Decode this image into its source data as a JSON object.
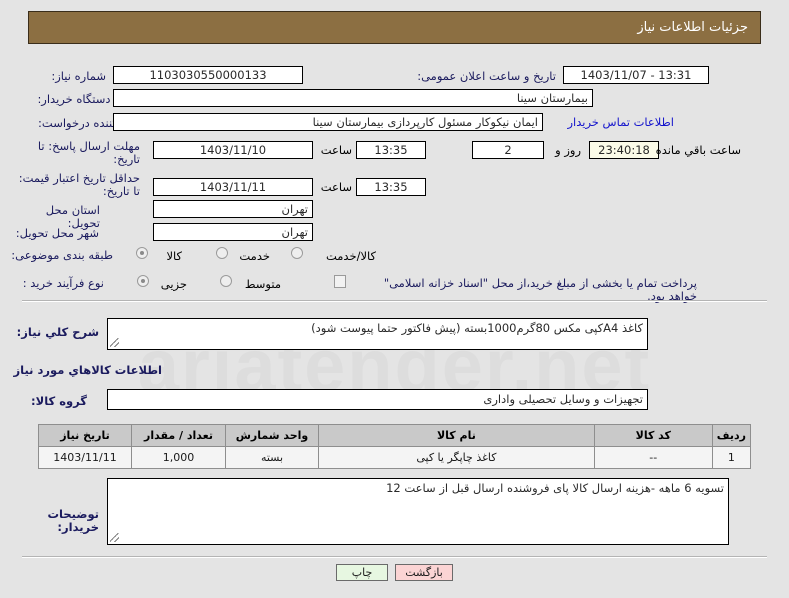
{
  "header": {
    "title": "جزئیات اطلاعات نیاز"
  },
  "watermark": {
    "text": "ariatender.net"
  },
  "fields": {
    "need_number_label": "شماره نیاز:",
    "need_number_value": "1103030550000133",
    "announce_label": "تاریخ و ساعت اعلان عمومی:",
    "announce_value": "13:31 - 1403/11/07",
    "buyer_org_label": "نام دستگاه خریدار:",
    "buyer_org_value": "بیمارستان سینا",
    "creator_label": "ایجاد کننده درخواست:",
    "creator_value": "ایمان نیکوکار مسئول کارپردازی  بیمارستان سینا",
    "contact_link": "اطلاعات تماس خریدار",
    "deadline_label": "مهلت ارسال پاسخ: تا تاریخ:",
    "deadline_date": "1403/11/10",
    "hour_label": "ساعت",
    "deadline_time": "13:35",
    "days_value": "2",
    "days_label": "روز و",
    "countdown_value": "23:40:18",
    "countdown_label": "ساعت باقي مانده",
    "validity_label": "حداقل تاریخ اعتبار قیمت: تا تاریخ:",
    "validity_date": "1403/11/11",
    "validity_time": "13:35",
    "province_label": "استان محل تحویل:",
    "province_value": "تهران",
    "city_label": "شهر محل تحویل:",
    "city_value": "تهران",
    "category_label": "طبقه بندی موضوعی:",
    "category_options": [
      {
        "label": "کالا",
        "selected": true
      },
      {
        "label": "خدمت",
        "selected": false
      },
      {
        "label": "کالا/خدمت",
        "selected": false
      }
    ],
    "process_label": "نوع فرآیند خرید :",
    "process_options": [
      {
        "label": "جزیی",
        "selected": true
      },
      {
        "label": "متوسط",
        "selected": false
      }
    ],
    "treasury_checkbox_label": "پرداخت تمام یا بخشی از مبلغ خرید،از محل \"اسناد خزانه اسلامی\" خواهد بود.",
    "treasury_checked": false,
    "summary_label": "شرح کلي نیاز:",
    "summary_value": "کاغذ A4کپی مکس 80گرم1000بسته (پیش فاکتور حتما پیوست شود)",
    "goods_section_title": "اطلاعات کالاهاي مورد نیاز",
    "goods_group_label": "گروه کالا:",
    "goods_group_value": "تجهیزات و وسایل تحصیلی واداری",
    "buyer_notes_label": "توضیحات خریدار:",
    "buyer_notes_value": "تسویه 6 ماهه -هزینه ارسال کالا پای فروشنده ارسال قبل از ساعت 12"
  },
  "goods_table": {
    "columns": [
      "ردیف",
      "کد کالا",
      "نام کالا",
      "واحد شمارش",
      "تعداد / مقدار",
      "تاریخ نیاز"
    ],
    "rows": [
      {
        "row": "1",
        "code": "--",
        "name": "کاغذ چاپگر یا کپی",
        "unit": "بسته",
        "quantity": "1,000",
        "need_date": "1403/11/11"
      }
    ]
  },
  "buttons": {
    "back": "بازگشت",
    "print": "چاپ"
  },
  "colors": {
    "header_bg": "#8c6f42",
    "link": "#1414cc",
    "label": "#1b1b5e",
    "back_btn": "#fbd4d4",
    "print_btn": "#e7f7e1",
    "table_header": "#c9c9c9"
  }
}
